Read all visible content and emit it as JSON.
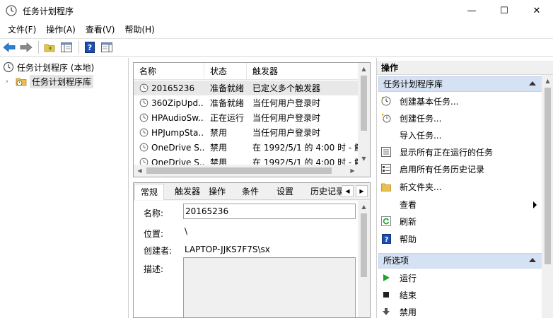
{
  "window": {
    "title": "任务计划程序",
    "minimize_glyph": "—",
    "maximize_glyph": "☐",
    "close_glyph": "✕"
  },
  "menu": [
    "文件(F)",
    "操作(A)",
    "查看(V)",
    "帮助(H)"
  ],
  "toolbar": {
    "buttons": [
      "back-arrow-icon",
      "forward-arrow-icon",
      "up-folder-icon",
      "show-hide-tree-icon",
      "help-icon",
      "show-hide-action-pane-icon"
    ]
  },
  "tree": {
    "root": "任务计划程序 (本地)",
    "child": "任务计划程序库"
  },
  "task_list": {
    "columns": [
      "名称",
      "状态",
      "触发器"
    ],
    "rows": [
      {
        "name": "20165236",
        "status": "准备就绪",
        "trigger": "已定义多个触发器"
      },
      {
        "name": "360ZipUpd...",
        "status": "准备就绪",
        "trigger": "当任何用户登录时"
      },
      {
        "name": "HPAudioSw...",
        "status": "正在运行",
        "trigger": "当任何用户登录时"
      },
      {
        "name": "HPJumpSta...",
        "status": "禁用",
        "trigger": "当任何用户登录时"
      },
      {
        "name": "OneDrive S...",
        "status": "禁用",
        "trigger": "在 1992/5/1 的 4:00 时 - 触"
      },
      {
        "name": "OneDrive S...",
        "status": "禁用",
        "trigger": "在 1992/5/1 的 4:00 时 - 触"
      }
    ]
  },
  "detail": {
    "tabs": [
      "常规",
      "触发器",
      "操作",
      "条件",
      "设置",
      "历史记录"
    ],
    "active_tab": "常规",
    "fields": {
      "name_label": "名称:",
      "name_value": "20165236",
      "location_label": "位置:",
      "location_value": "\\",
      "author_label": "创建者:",
      "author_value": "LAPTOP-JJKS7F7S\\sx",
      "description_label": "描述:"
    }
  },
  "actions": {
    "title": "操作",
    "section1": {
      "header": "任务计划程序库",
      "items": [
        {
          "label": "创建基本任务...",
          "icon": "create-basic-task-icon"
        },
        {
          "label": "创建任务...",
          "icon": "create-task-icon"
        },
        {
          "label": "导入任务...",
          "icon": ""
        },
        {
          "label": "显示所有正在运行的任务",
          "icon": "running-tasks-icon"
        },
        {
          "label": "启用所有任务历史记录",
          "icon": "history-icon"
        },
        {
          "label": "新文件夹...",
          "icon": "new-folder-icon"
        },
        {
          "label": "查看",
          "icon": ""
        },
        {
          "label": "刷新",
          "icon": "refresh-icon"
        },
        {
          "label": "帮助",
          "icon": "help-icon"
        }
      ]
    },
    "section2": {
      "header": "所选项",
      "items": [
        {
          "label": "运行",
          "icon": "run-icon"
        },
        {
          "label": "结束",
          "icon": "end-icon"
        },
        {
          "label": "禁用",
          "icon": "disable-icon"
        }
      ]
    }
  },
  "colors": {
    "section_header_bg": "#d5e2f3",
    "selection_bg": "#e8e8e8",
    "run_green": "#1fa22e",
    "help_blue": "#1c4fb3"
  }
}
